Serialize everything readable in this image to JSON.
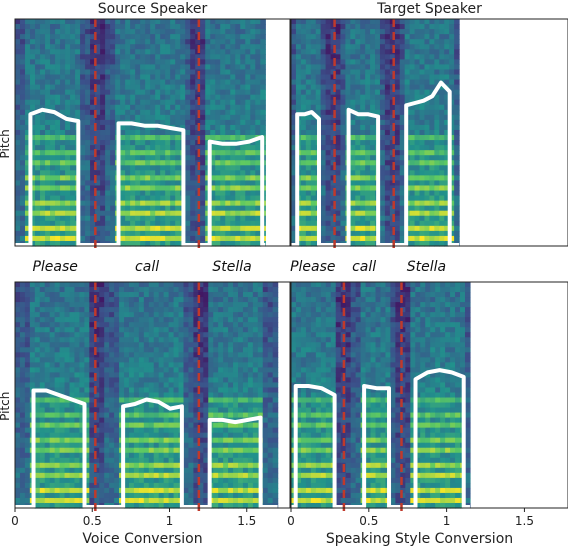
{
  "chart_data": {
    "type": "heatmap",
    "description": "Four spectrogram panels with pitch contours and word boundaries",
    "palette": [
      "#440154",
      "#3b528b",
      "#21918c",
      "#5ec962",
      "#fde725"
    ],
    "contour_color": "#ffffff",
    "boundary_color": "#c0392b",
    "panels": [
      {
        "id": "source",
        "title": "Source Speaker",
        "xlabel": "",
        "ylabel": "Pitch",
        "xlim": [
          0,
          1.78
        ],
        "duration": 1.62,
        "boundaries": [
          0.52,
          1.19
        ],
        "words": [
          "Please",
          "call",
          "Stella"
        ],
        "segments": [
          {
            "start": 0.1,
            "end": 0.41,
            "level": [
              0.58,
              0.6,
              0.59,
              0.56,
              0.55
            ]
          },
          {
            "start": 0.67,
            "end": 1.09,
            "level": [
              0.54,
              0.54,
              0.53,
              0.53,
              0.52,
              0.51
            ]
          },
          {
            "start": 1.26,
            "end": 1.6,
            "level": [
              0.46,
              0.45,
              0.45,
              0.46,
              0.48
            ]
          }
        ]
      },
      {
        "id": "target",
        "title": "Target Speaker",
        "xlabel": "",
        "ylabel": "",
        "xlim": [
          0,
          1.78
        ],
        "duration": 1.08,
        "boundaries": [
          0.28,
          0.66
        ],
        "words": [
          "Please",
          "call",
          "Stella"
        ],
        "segments": [
          {
            "start": 0.04,
            "end": 0.18,
            "level": [
              0.58,
              0.58,
              0.59,
              0.56
            ]
          },
          {
            "start": 0.37,
            "end": 0.56,
            "level": [
              0.6,
              0.58,
              0.58,
              0.57
            ]
          },
          {
            "start": 0.74,
            "end": 1.02,
            "level": [
              0.62,
              0.63,
              0.64,
              0.66,
              0.72,
              0.68
            ]
          }
        ]
      },
      {
        "id": "voice",
        "title": "",
        "xlabel": "Voice Conversion",
        "ylabel": "Pitch",
        "xlim": [
          0,
          1.78
        ],
        "duration": 1.7,
        "boundaries": [
          0.52,
          1.19
        ],
        "words": [],
        "segments": [
          {
            "start": 0.12,
            "end": 0.45,
            "level": [
              0.52,
              0.52,
              0.5,
              0.48,
              0.46
            ]
          },
          {
            "start": 0.7,
            "end": 1.08,
            "level": [
              0.45,
              0.46,
              0.48,
              0.47,
              0.44,
              0.45
            ]
          },
          {
            "start": 1.26,
            "end": 1.59,
            "level": [
              0.39,
              0.39,
              0.38,
              0.39,
              0.4
            ]
          }
        ]
      },
      {
        "id": "style",
        "title": "",
        "xlabel": "Speaking Style Conversion",
        "ylabel": "",
        "xlim": [
          0,
          1.78
        ],
        "duration": 1.15,
        "boundaries": [
          0.34,
          0.71
        ],
        "words": [],
        "segments": [
          {
            "start": 0.03,
            "end": 0.28,
            "level": [
              0.54,
              0.54,
              0.53,
              0.5
            ]
          },
          {
            "start": 0.47,
            "end": 0.63,
            "level": [
              0.54,
              0.53,
              0.53
            ]
          },
          {
            "start": 0.8,
            "end": 1.11,
            "level": [
              0.57,
              0.6,
              0.61,
              0.6,
              0.58
            ]
          }
        ]
      }
    ],
    "xticks": [
      0,
      0.5,
      1,
      1.5
    ],
    "xtick_labels": [
      "0",
      "0.5",
      "1",
      "1.5"
    ]
  }
}
